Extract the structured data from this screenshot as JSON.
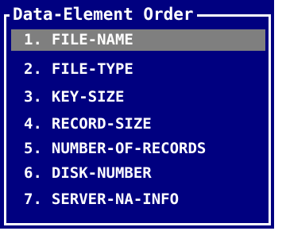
{
  "window": {
    "title": "Data-Element Order"
  },
  "list": {
    "selected_index": 0,
    "items": [
      {
        "number": "1.",
        "label": "FILE-NAME"
      },
      {
        "number": "2.",
        "label": "FILE-TYPE"
      },
      {
        "number": "3.",
        "label": "KEY-SIZE"
      },
      {
        "number": "4.",
        "label": "RECORD-SIZE"
      },
      {
        "number": "5.",
        "label": "NUMBER-OF-RECORDS"
      },
      {
        "number": "6.",
        "label": "DISK-NUMBER"
      },
      {
        "number": "7.",
        "label": "SERVER-NA-INFO"
      }
    ]
  },
  "colors": {
    "background": "#000080",
    "text": "#ffffff",
    "selection": "#7f7f7f",
    "border": "#ffffff"
  }
}
